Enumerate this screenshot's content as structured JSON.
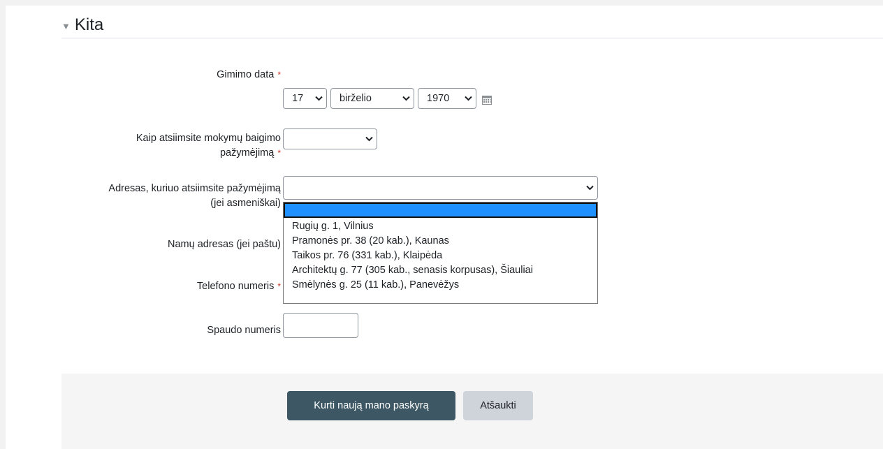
{
  "section": {
    "title": "Kita",
    "collapse_icon": "triangle-down-icon"
  },
  "birth_date": {
    "label": "Gimimo data",
    "day": "17",
    "month": "birželio",
    "year": "1970",
    "calendar_icon": "calendar-icon"
  },
  "certificate_method": {
    "label_line1": "Kaip atsiimsite mokymų baigimo",
    "label_line2": "pažymėjimą",
    "value": ""
  },
  "pickup_address": {
    "label_line1": "Adresas, kuriuo atsiimsite pažymėjimą",
    "label_line2": "(jei asmeniškai)",
    "value": "",
    "options": [
      "",
      "Rugių g. 1, Vilnius",
      "Pramonės pr. 38 (20 kab.), Kaunas",
      "Taikos pr. 76 (331 kab.), Klaipėda",
      "Architektų g. 77 (305 kab., senasis korpusas), Šiauliai",
      "Smėlynės g. 25 (11 kab.), Panevėžys"
    ]
  },
  "home_address": {
    "label": "Namų adresas (jei paštu)"
  },
  "phone": {
    "label": "Telefono numeris"
  },
  "stamp_number": {
    "label": "Spaudo numeris",
    "value": ""
  },
  "required_marker": "*",
  "buttons": {
    "submit": "Kurti naują mano paskyrą",
    "cancel": "Atšaukti"
  },
  "colors": {
    "primary_button": "#3d5864",
    "required": "#ca3120",
    "highlight": "#1e90ff"
  }
}
